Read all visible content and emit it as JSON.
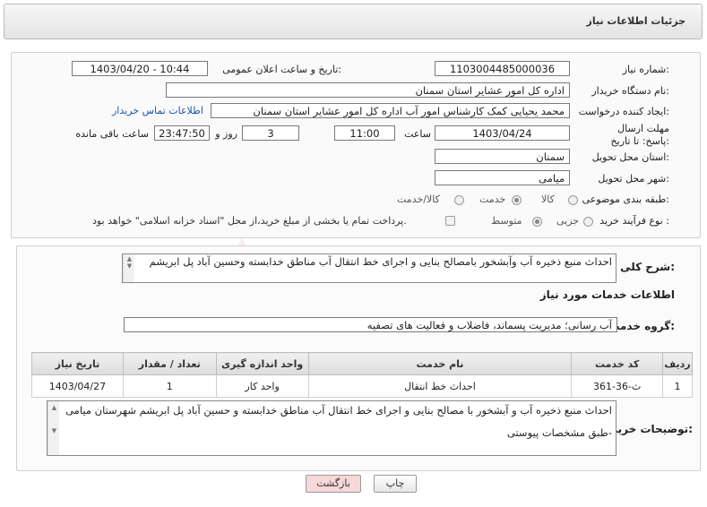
{
  "header": {
    "title": "جزئیات اطلاعات نیاز"
  },
  "form": {
    "need_number": {
      "label": "شماره نیاز:",
      "value": "1103004485000036"
    },
    "announce_datetime": {
      "label": "تاریخ و ساعت اعلان عمومی:",
      "value": "1403/04/20 - 10:44"
    },
    "buyer_org": {
      "label": "نام دستگاه خریدار:",
      "value": "اداره کل امور عشایر استان سمنان"
    },
    "requester": {
      "label": "ایجاد کننده درخواست:",
      "value": "محمد یحیایی کمک کارشناس امور آب اداره کل امور عشایر استان سمنان",
      "contact_link": "اطلاعات تماس خریدار"
    },
    "deadline": {
      "label": "مهلت ارسال پاسخ: تا تاریخ:",
      "date": "1403/04/24",
      "time_label": "ساعت",
      "time": "11:00",
      "days": "3",
      "days_label": "روز و",
      "remaining": "23:47:50",
      "remaining_label": "ساعت باقی مانده"
    },
    "province": {
      "label": "استان محل تحویل:",
      "value": "سمنان"
    },
    "city": {
      "label": "شهر محل تحویل:",
      "value": "میامی"
    },
    "category": {
      "label": "طبقه بندی موضوعی:",
      "options": [
        "کالا",
        "خدمت",
        "کالا/خدمت"
      ],
      "selected": "خدمت"
    },
    "purchase_type": {
      "label": "نوع فرآیند خرید :",
      "options": [
        "جزیی",
        "متوسط"
      ],
      "selected": "متوسط",
      "payment_note": "پرداخت تمام یا بخشی از مبلغ خرید،از محل \"اسناد خزانه اسلامی\" خواهد بود."
    }
  },
  "summary": {
    "label": "شرح کلی نیاز:",
    "text": "احداث منبع ذخیره آب وآبشخور بامصالح بنایی و اجرای خط انتقال آب مناطق خدابسته وحسین آباد پل ابریشم"
  },
  "services": {
    "section_title": "اطلاعات خدمات مورد نیاز",
    "group_label": "گروه خدمت:",
    "group_value": "آب رسانی؛ مدیریت پسماند، فاضلاب و فعالیت های تصفیه",
    "columns": [
      "ردیف",
      "کد خدمت",
      "نام خدمت",
      "واحد اندازه گیری",
      "تعداد / مقدار",
      "تاریخ نیاز"
    ],
    "rows": [
      {
        "row": "1",
        "code": "ث-36-361",
        "name": "احداث خط انتقال",
        "unit": "واحد کار",
        "qty": "1",
        "date": "1403/04/27"
      }
    ]
  },
  "buyer_notes": {
    "label": "توضیحات خریدار:",
    "lines": [
      "احداث منبع ذخیره آب و آبشخور با مصالح بنایی و اجرای خط انتقال آب مناطق خدابسته و حسین آباد پل ابریشم شهرستان میامی",
      "-طبق مشخصات پیوستی"
    ]
  },
  "buttons": {
    "print": "چاپ",
    "back": "بازگشت"
  },
  "watermark": {
    "text": "AriaTender.neT"
  },
  "colors": {
    "link": "#1a55b5",
    "back_button_bg": "#f7d7d7",
    "watermark": "#e23c3c"
  }
}
